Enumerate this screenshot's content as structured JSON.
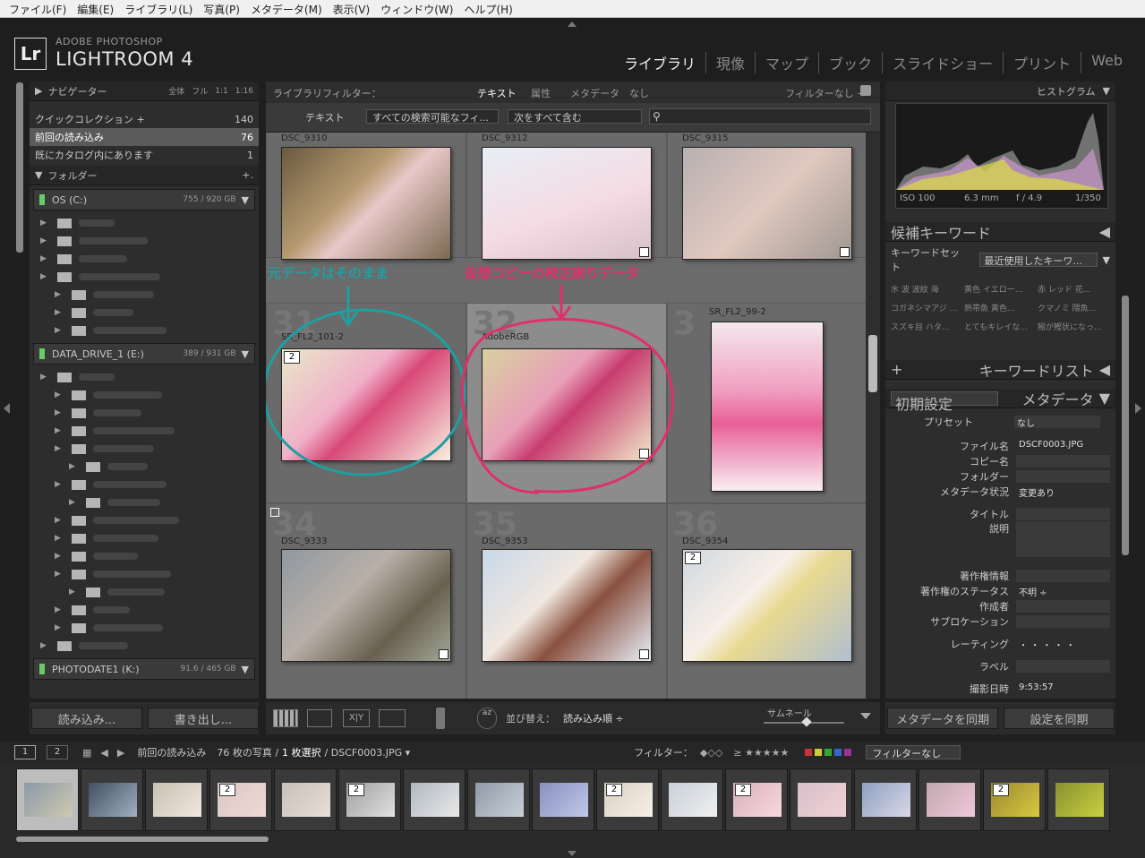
{
  "menu": [
    "ファイル(F)",
    "編集(E)",
    "ライブラリ(L)",
    "写真(P)",
    "メタデータ(M)",
    "表示(V)",
    "ウィンドウ(W)",
    "ヘルプ(H)"
  ],
  "brand": {
    "logo": "Lr",
    "small": "ADOBE PHOTOSHOP",
    "big": "LIGHTROOM 4"
  },
  "modules": [
    "ライブラリ",
    "現像",
    "マップ",
    "ブック",
    "スライドショー",
    "プリント",
    "Web"
  ],
  "navigator": {
    "label": "ナビゲーター",
    "opts": [
      "全体",
      "フル",
      "1:1",
      "1:16"
    ]
  },
  "catalog": [
    {
      "label": "クイックコレクション +",
      "count": "140"
    },
    {
      "label": "前回の読み込み",
      "count": "76"
    },
    {
      "label": "既にカタログ内にあります",
      "count": "1"
    }
  ],
  "folders": {
    "label": "フォルダー",
    "plus": "+."
  },
  "drives": [
    {
      "name": "OS (C:)",
      "size": "755 / 920 GB"
    },
    {
      "name": "DATA_DRIVE_1 (E:)",
      "size": "389 / 931 GB"
    },
    {
      "name": "PHOTODATE1 (K:)",
      "size": "91.6 / 465 GB"
    }
  ],
  "left_buttons": {
    "import": "読み込み...",
    "export": "書き出し..."
  },
  "filterbar": {
    "label": "ライブラリフィルター：",
    "tabs": [
      "テキスト",
      "属性",
      "メタデータ",
      "なし"
    ],
    "preset": "フィルターなし ÷",
    "text_label": "テキスト",
    "select1": "すべての検索可能なフィ...",
    "select2": "次をすべて含む"
  },
  "grid": [
    {
      "num": "",
      "name": "DSC_9310"
    },
    {
      "num": "",
      "name": "DSC_9312"
    },
    {
      "num": "",
      "name": "DSC_9315"
    },
    {
      "num": "31",
      "name": "SR_FL2_101-2"
    },
    {
      "num": "32",
      "name": "AdobeRGB"
    },
    {
      "num": "3",
      "name": "SR_FL2_99-2"
    },
    {
      "num": "34",
      "name": "DSC_9333"
    },
    {
      "num": "35",
      "name": "DSC_9353"
    },
    {
      "num": "36",
      "name": "DSC_9354"
    }
  ],
  "annotations": {
    "left": "元データはそのまま",
    "right": "仮想コピーの校正刷りデータ"
  },
  "virtual_badge": "2",
  "toolbar": {
    "sort_label": "並び替え：",
    "sort_value": "読み込み順 ÷",
    "thumb_label": "サムネール"
  },
  "histogram": {
    "label": "ヒストグラム",
    "iso": "ISO 100",
    "focal": "6.3 mm",
    "fstop": "f / 4.9",
    "shutter": "1/350"
  },
  "keyword_sugg": {
    "label": "候補キーワード",
    "set_label": "キーワードセット",
    "set_value": "最近使用したキーワ...",
    "words": [
      "水 波 波紋 海",
      "黄色 イエロー...",
      "赤 レッド 花...",
      "コガネシマアジ ...",
      "熱帯魚 黄色...",
      "クマノミ 隈魚...",
      "スズキ目 ハタ...",
      "とてもキレイな...",
      "鰯が鰹状になっ..."
    ]
  },
  "keyword_list": {
    "plus": "+",
    "label": "キーワードリスト"
  },
  "metadata": {
    "preset_sel": "初期設定",
    "label": "メタデータ",
    "preset_label": "プリセット",
    "preset_value": "なし",
    "rows": [
      {
        "l": "ファイル名",
        "v": "DSCF0003.JPG"
      },
      {
        "l": "コピー名",
        "v": ""
      },
      {
        "l": "フォルダー",
        "v": ""
      },
      {
        "l": "メタデータ状況",
        "v": "変更あり"
      },
      {
        "l": "タイトル",
        "v": ""
      },
      {
        "l": "説明",
        "v": ""
      },
      {
        "l": "著作権情報",
        "v": ""
      },
      {
        "l": "著作権のステータス",
        "v": "不明 ÷"
      },
      {
        "l": "作成者",
        "v": ""
      },
      {
        "l": "サブロケーション",
        "v": ""
      },
      {
        "l": "レーティング",
        "v": "・ ・ ・ ・ ・"
      },
      {
        "l": "ラベル",
        "v": ""
      },
      {
        "l": "撮影日時",
        "v": "9:53:57"
      }
    ]
  },
  "right_buttons": {
    "sync_meta": "メタデータを同期",
    "sync_settings": "設定を同期"
  },
  "filmstrip_bar": {
    "v1": "1",
    "v2": "2",
    "source": "前回の読み込み",
    "count": "76 枚の写真 /",
    "selected": "1 枚選択",
    "file": "/ DSCF0003.JPG ▾",
    "filter_label": "フィルター：",
    "filter_value": "フィルターなし"
  },
  "colors": {
    "annotation_teal": "#1f9fa0",
    "annotation_pink": "#e0306a",
    "accent": "#5a5a5a"
  }
}
